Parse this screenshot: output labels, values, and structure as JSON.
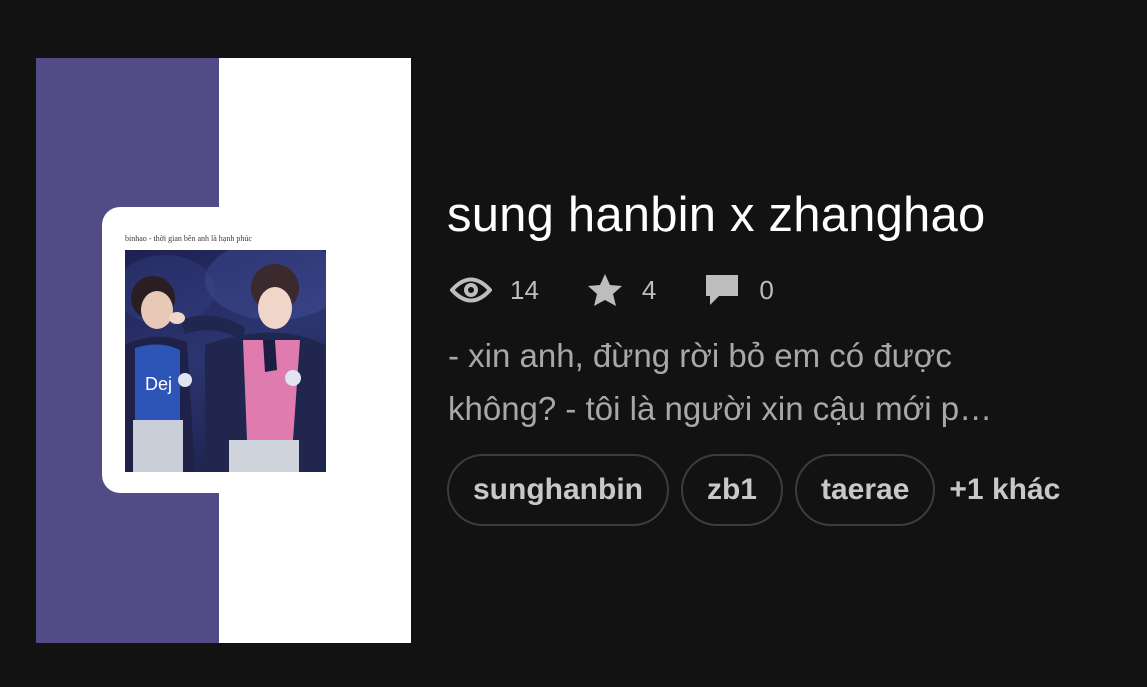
{
  "story": {
    "title": "sung hanbin x zhanghao",
    "stats": {
      "views": "14",
      "votes": "4",
      "comments": "0"
    },
    "description_lines": [
      "- xin anh, đừng rời bỏ em có được",
      "không? - tôi là người xin cậu mới p…"
    ],
    "tags": [
      "sunghanbin",
      "zb1",
      "taerae"
    ],
    "more_tags": "+1 khác"
  },
  "cover": {
    "caption": "binhao - thời gian bên anh là hạnh phúc",
    "band_color": "#514b86"
  },
  "icons": {
    "views": "eye-icon",
    "votes": "star-icon",
    "comments": "comment-bubble-icon"
  },
  "colors": {
    "background": "#121212",
    "title": "#ffffff",
    "muted_text": "#a8a8a8",
    "tag_border": "#3c3c3c"
  }
}
